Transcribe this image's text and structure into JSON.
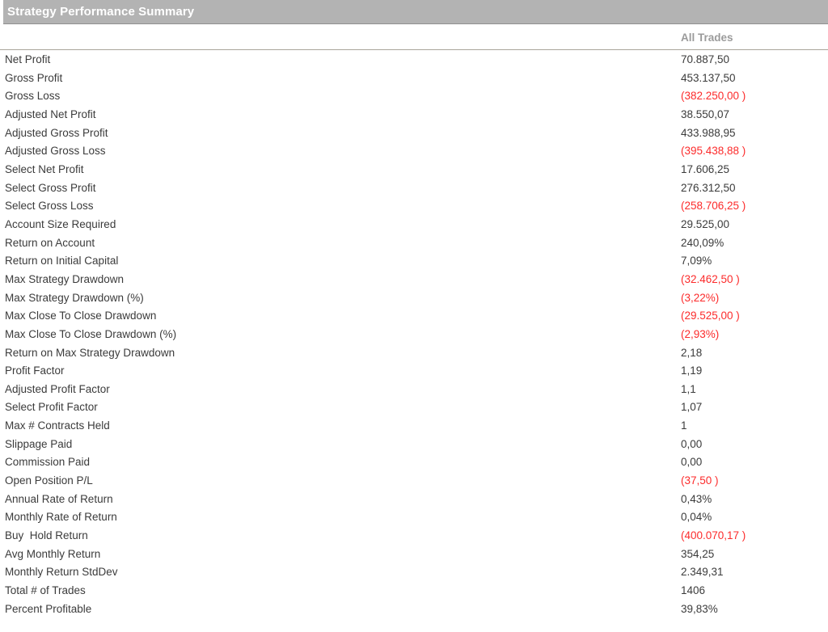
{
  "report": {
    "title": "Strategy Performance Summary",
    "columns": [
      "All Trades"
    ],
    "accent_header_bg": "#b3b3b3",
    "accent_header_text": "#ffffff",
    "column_header_color": "#9b9b9b",
    "label_color": "#3b3b3b",
    "negative_color": "#fc2b2b",
    "rows": [
      {
        "label": "Net Profit",
        "value": "70.887,50",
        "negative": false
      },
      {
        "label": "Gross Profit",
        "value": "453.137,50",
        "negative": false
      },
      {
        "label": "Gross Loss",
        "value": "(382.250,00 )",
        "negative": true
      },
      {
        "label": "Adjusted Net Profit",
        "value": "38.550,07",
        "negative": false
      },
      {
        "label": "Adjusted Gross Profit",
        "value": "433.988,95",
        "negative": false
      },
      {
        "label": "Adjusted Gross Loss",
        "value": "(395.438,88 )",
        "negative": true
      },
      {
        "label": "Select Net Profit",
        "value": "17.606,25",
        "negative": false
      },
      {
        "label": "Select Gross Profit",
        "value": "276.312,50",
        "negative": false
      },
      {
        "label": "Select Gross Loss",
        "value": "(258.706,25 )",
        "negative": true
      },
      {
        "label": "Account Size Required",
        "value": "29.525,00",
        "negative": false
      },
      {
        "label": "Return on Account",
        "value": "240,09%",
        "negative": false
      },
      {
        "label": "Return on Initial Capital",
        "value": "7,09%",
        "negative": false
      },
      {
        "label": "Max Strategy Drawdown",
        "value": "(32.462,50 )",
        "negative": true
      },
      {
        "label": "Max Strategy Drawdown (%)",
        "value": "(3,22%)",
        "negative": true
      },
      {
        "label": "Max Close To Close Drawdown",
        "value": "(29.525,00 )",
        "negative": true
      },
      {
        "label": "Max Close To Close Drawdown (%)",
        "value": "(2,93%)",
        "negative": true
      },
      {
        "label": "Return on Max Strategy Drawdown",
        "value": "2,18",
        "negative": false
      },
      {
        "label": "Profit Factor",
        "value": "1,19",
        "negative": false
      },
      {
        "label": "Adjusted Profit Factor",
        "value": "1,1",
        "negative": false
      },
      {
        "label": "Select Profit Factor",
        "value": "1,07",
        "negative": false
      },
      {
        "label": "Max # Contracts Held",
        "value": "1",
        "negative": false
      },
      {
        "label": "Slippage Paid",
        "value": "0,00",
        "negative": false
      },
      {
        "label": "Commission Paid",
        "value": "0,00",
        "negative": false
      },
      {
        "label": "Open Position P/L",
        "value": "(37,50 )",
        "negative": true
      },
      {
        "label": "Annual Rate of Return",
        "value": "0,43%",
        "negative": false
      },
      {
        "label": "Monthly Rate of Return",
        "value": "0,04%",
        "negative": false
      },
      {
        "label": "Buy  Hold Return",
        "value": "(400.070,17 )",
        "negative": true
      },
      {
        "label": "Avg Monthly Return",
        "value": "354,25",
        "negative": false
      },
      {
        "label": "Monthly Return StdDev",
        "value": "2.349,31",
        "negative": false
      },
      {
        "label": "Total # of Trades",
        "value": "1406",
        "negative": false
      },
      {
        "label": "Percent Profitable",
        "value": "39,83%",
        "negative": false
      }
    ]
  }
}
